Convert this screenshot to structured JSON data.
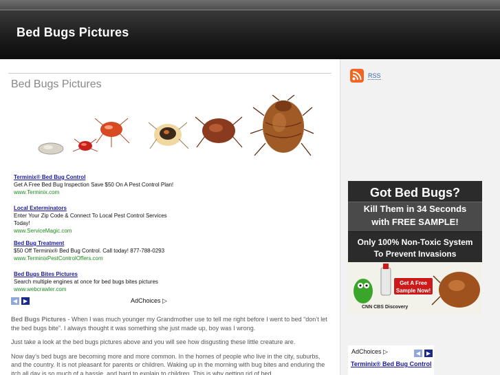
{
  "header": {
    "site_title": "Bed Bugs Pictures"
  },
  "main": {
    "page_title": "Bed Bugs Pictures",
    "ads": [
      {
        "title": "Terminix® Bed Bug Control",
        "desc": "Get A Free Bed Bug Inspection Save $50 On A Pest Control Plan!",
        "url": "www.Terminix.com"
      },
      {
        "title": "Local Exterminators",
        "desc": "Enter Your Zip Code & Connect To Local Pest Control Services Today!",
        "url": "www.ServiceMagic.com"
      },
      {
        "title": "Bed Bug Treatment",
        "desc": "$50 Off Terminix® Bed Bug Control. Call today! 877-788-0293",
        "url": "www.TerminixPestControlOffers.com"
      },
      {
        "title": "Bed Bugs Bites Pictures",
        "desc": "Search multiple engines at once for bed bugs bites pictures",
        "url": "www.webcrawler.com"
      }
    ],
    "adchoices": "AdChoices",
    "paragraphs": {
      "p1_lead": "Bed Bugs Pictures",
      "p1_text": " -  When I was much younger my Grandmother use to tell me right before I went to bed “don’t let the bed bugs bite”. I always thought it was something she just made up, boy was I wrong.",
      "p2": "Just take a look at the bed bugs pictures above and you will see how disgusting these little creature are.",
      "p3": "Now day’s bed bugs are becoming more and more common. In the homes of people who live in the city, suburbs, and the country. It is not pleasant for parents or children. Waking up in the morning with bug bites and enduring the itch all day is so much of a hassle, and hard to explain to children. This is why getting rid of bed"
    }
  },
  "sidebar": {
    "rss_label": "RSS",
    "promo": {
      "headline": "Got Bed Bugs?",
      "sub1": "Kill Them in 34 Seconds",
      "sub2": "with FREE SAMPLE!",
      "tag1": "Only 100% Non-Toxic System",
      "tag2": "To Prevent Invasions",
      "cta": "Get A Free Sample Now!",
      "logos": "CNN  CBS  Discovery"
    },
    "adchoices": "AdChoices",
    "ad_title": "Terminix® Bed Bug Control"
  },
  "colors": {
    "link": "#1a1a9a",
    "url": "#1d8a1d",
    "header_bg": "#1a1a1a",
    "rss": "#f26522"
  }
}
